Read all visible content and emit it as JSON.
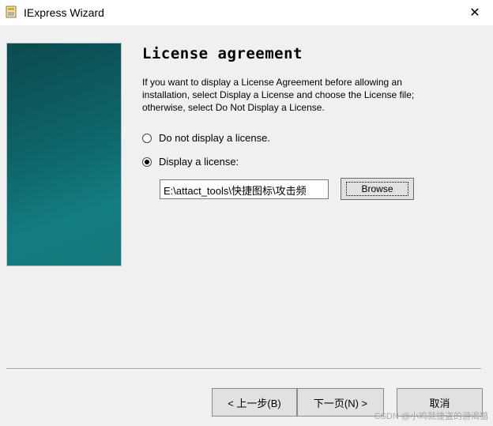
{
  "window": {
    "title": "IExpress Wizard",
    "close_glyph": "✕"
  },
  "page": {
    "heading": "License agreement",
    "description": "If you want to display a License Agreement before allowing an installation, select Display a License and choose the License file; otherwise, select Do Not Display a License."
  },
  "options": [
    {
      "label": "Do not display a license.",
      "checked": false
    },
    {
      "label": "Display a license:",
      "checked": true
    }
  ],
  "license_file": {
    "value": "E:\\attact_tools\\快捷图标\\攻击频"
  },
  "browse_label": "Browse",
  "buttons": {
    "back": "< 上一步(B)",
    "next": "下一页(N) >",
    "cancel": "取消"
  },
  "watermark": "CSDN @小鸡就捷盗的游渴猫",
  "icons": {
    "app": "iexpress-app-icon",
    "close": "close-icon"
  }
}
